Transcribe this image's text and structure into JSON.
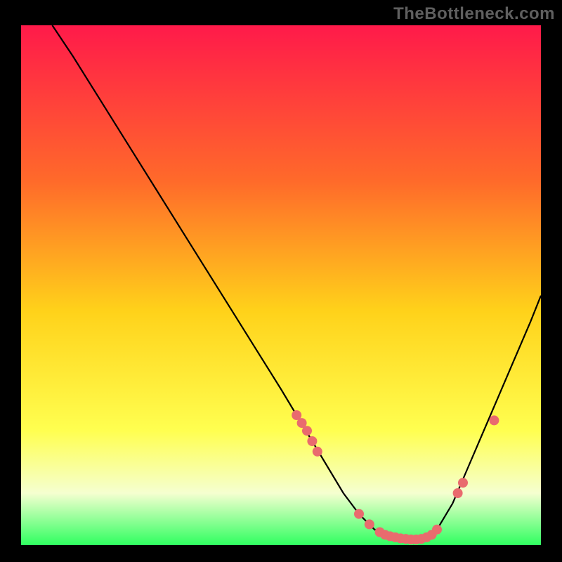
{
  "watermark": "TheBottleneck.com",
  "colors": {
    "background": "#000000",
    "watermark": "#5f5f5f",
    "gradient_top": "#ff1a4a",
    "gradient_mid1": "#ff6a2a",
    "gradient_mid2": "#ffd21a",
    "gradient_mid3": "#ffff50",
    "gradient_bottom_band": "#f5ffd0",
    "gradient_bottom": "#2fff60",
    "curve": "#000000",
    "dots": "#e96b6e"
  },
  "chart_data": {
    "type": "line",
    "title": "",
    "xlabel": "",
    "ylabel": "",
    "xlim": [
      0,
      100
    ],
    "ylim": [
      0,
      100
    ],
    "series": [
      {
        "name": "bottleneck-curve",
        "x": [
          6,
          10,
          15,
          20,
          25,
          30,
          35,
          40,
          45,
          50,
          53,
          56,
          59,
          62,
          65,
          68,
          71,
          74,
          77,
          80,
          83,
          86,
          89,
          92,
          95,
          98,
          100
        ],
        "y": [
          100,
          94,
          86,
          78,
          70,
          62,
          54,
          46,
          38,
          30,
          25,
          20,
          15,
          10,
          6,
          3,
          1.5,
          1,
          1,
          3,
          8,
          15,
          22,
          29,
          36,
          43,
          48
        ]
      }
    ],
    "scatter_points": {
      "name": "highlight-dots",
      "x": [
        53,
        54,
        55,
        56,
        57,
        65,
        67,
        69,
        70,
        71,
        72,
        73,
        74,
        75,
        76,
        77,
        78,
        79,
        80,
        84,
        85,
        91
      ],
      "y": [
        25,
        23.5,
        22,
        20,
        18,
        6,
        4,
        2.5,
        2,
        1.7,
        1.5,
        1.3,
        1.2,
        1.1,
        1.1,
        1.2,
        1.5,
        2,
        3,
        10,
        12,
        24
      ]
    }
  }
}
